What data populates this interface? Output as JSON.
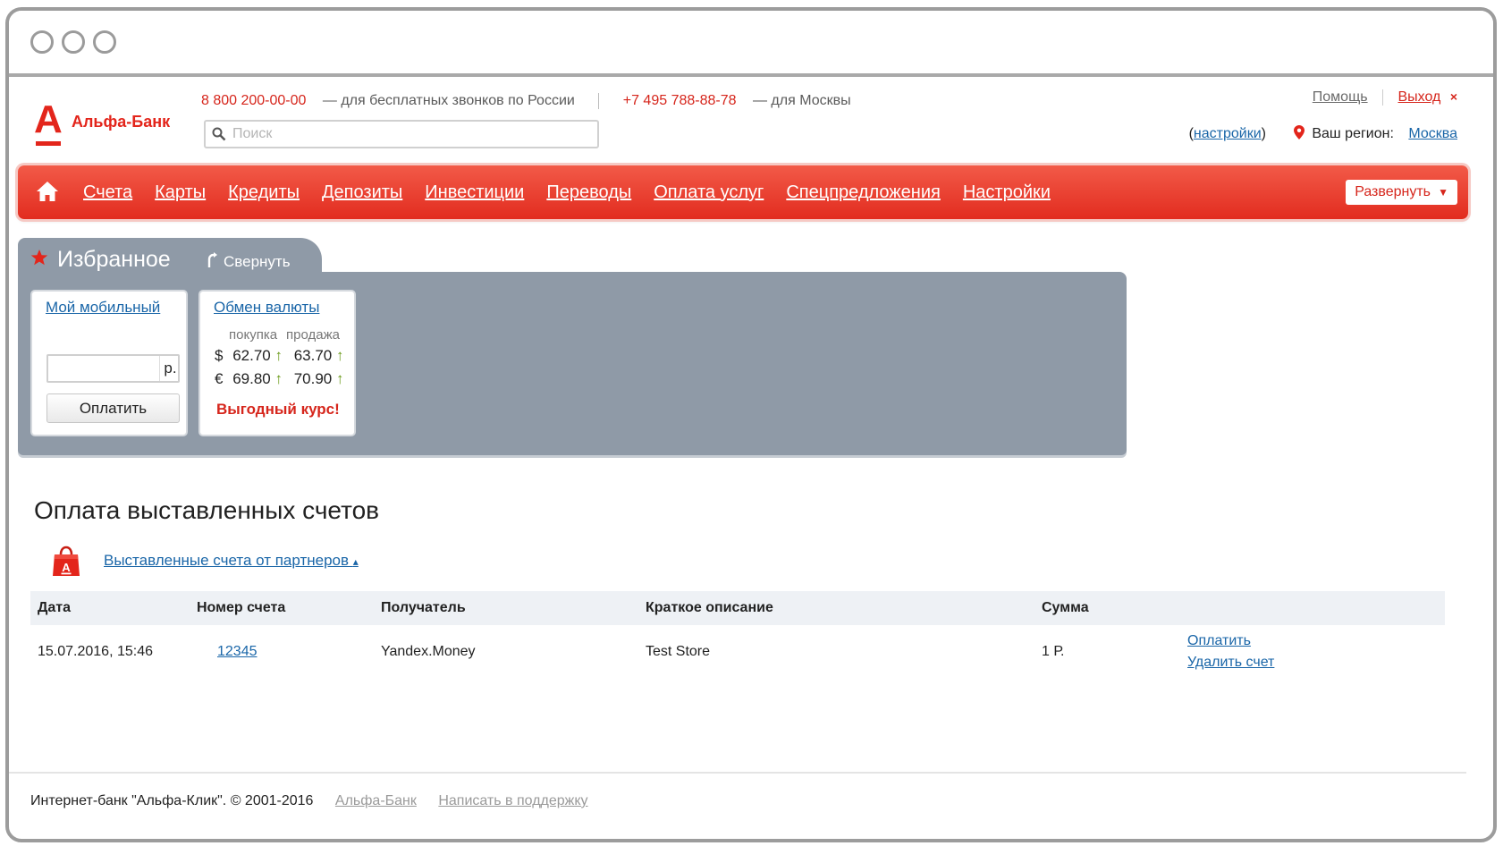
{
  "window": {
    "controls": [
      "close",
      "minimize",
      "maximize"
    ]
  },
  "brand": {
    "logo_letter": "А",
    "name": "Альфа-Банк",
    "accent_color": "#e3251b"
  },
  "contacts": {
    "free_phone": "8 800 200-00-00",
    "free_phone_note": "— для бесплатных звонков по России",
    "moscow_phone": "+7 495 788-88-78",
    "moscow_phone_note": "— для Москвы"
  },
  "search": {
    "placeholder": "Поиск",
    "value": ""
  },
  "top_links": {
    "help": "Помощь",
    "logout": "Выход",
    "logout_icon": "×"
  },
  "region": {
    "settings_open": "(",
    "settings_label": "настройки",
    "settings_close": ")",
    "label": "Ваш регион:",
    "value": "Москва"
  },
  "nav": {
    "items": [
      "Счета",
      "Карты",
      "Кредиты",
      "Депозиты",
      "Инвестиции",
      "Переводы",
      "Оплата услуг",
      "Спецпредложения",
      "Настройки"
    ],
    "expand_label": "Развернуть",
    "expand_arrow": "▼"
  },
  "favorites": {
    "title": "Избранное",
    "collapse_label": "Свернуть",
    "mobile": {
      "title": "Мой мобильный",
      "amount_value": "",
      "currency": "р.",
      "pay_label": "Оплатить"
    },
    "exchange": {
      "title": "Обмен валюты",
      "buy_label": "покупка",
      "sell_label": "продажа",
      "rates": [
        {
          "symbol": "$",
          "buy": "62.70",
          "sell": "63.70",
          "trend": "↑"
        },
        {
          "symbol": "€",
          "buy": "69.80",
          "sell": "70.90",
          "trend": "↑"
        }
      ],
      "promo": "Выгодный курс!"
    }
  },
  "invoices": {
    "title": "Оплата выставленных счетов",
    "partners_link": "Выставленные счета от партнеров",
    "partners_arrow": "▴",
    "columns": [
      "Дата",
      "Номер счета",
      "Получатель",
      "Краткое описание",
      "Сумма"
    ],
    "rows": [
      {
        "date": "15.07.2016, 15:46",
        "number": "12345",
        "recipient": "Yandex.Money",
        "description": "Test Store",
        "amount": "1 Р.",
        "pay_action": "Оплатить",
        "delete_action": "Удалить счет"
      }
    ]
  },
  "footer": {
    "copyright": "Интернет-банк \"Альфа-Клик\". © 2001-2016",
    "link_bank": "Альфа-Банк",
    "link_support": "Написать в поддержку"
  }
}
